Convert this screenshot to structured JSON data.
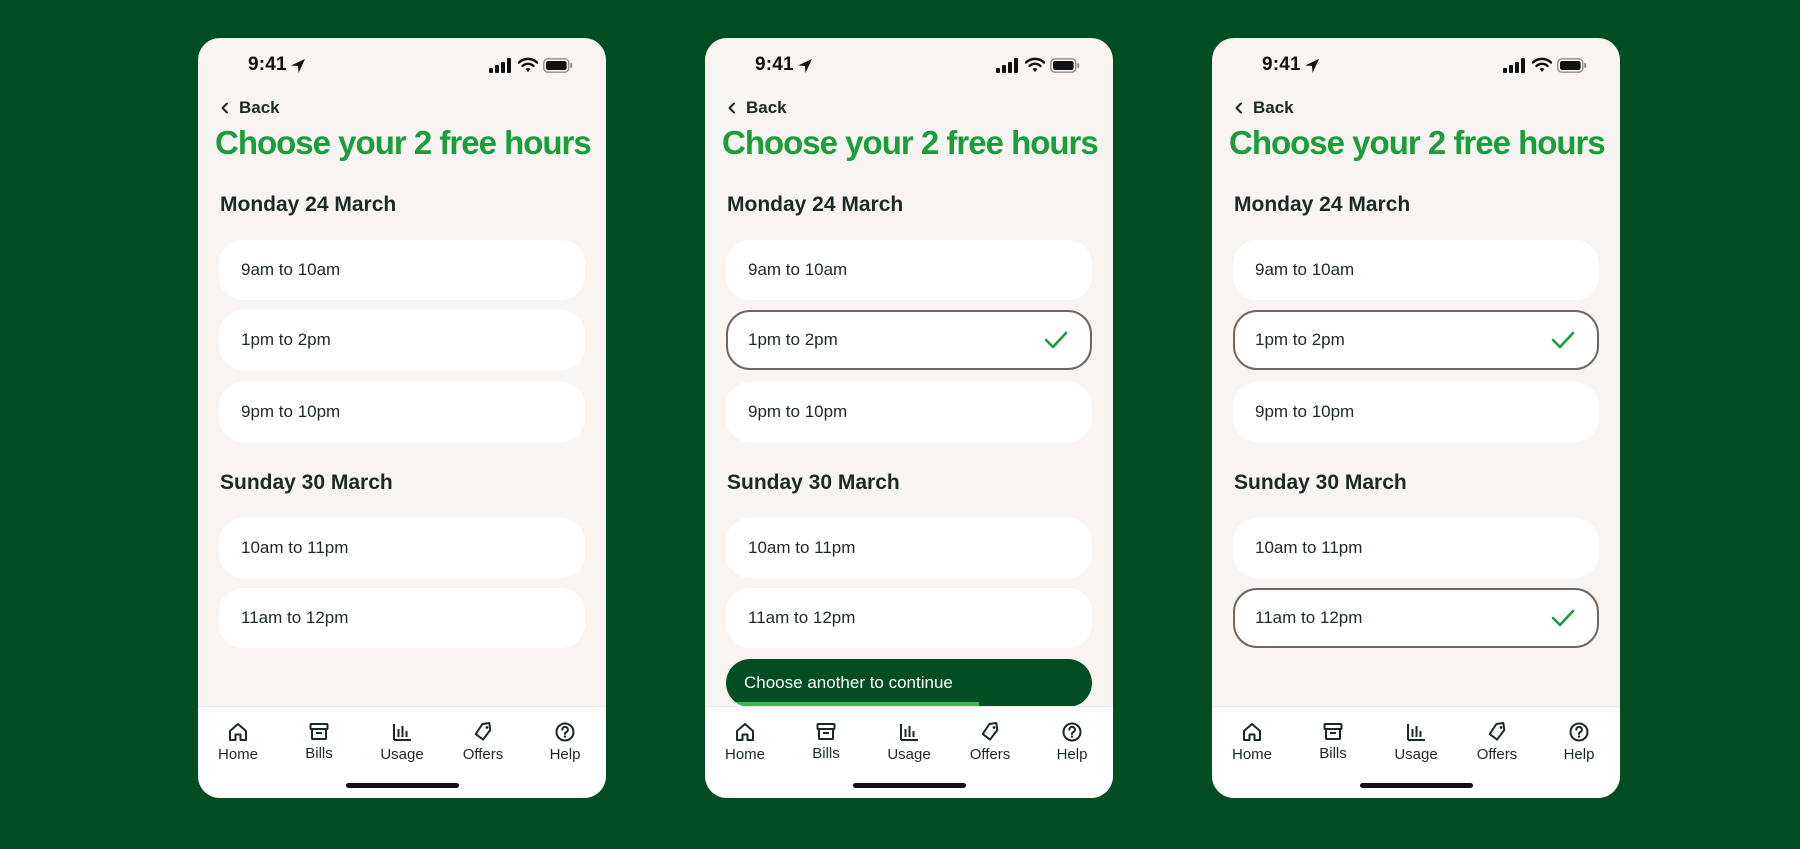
{
  "colors": {
    "background": "#034d22",
    "screen": "#f7f4f1",
    "card": "#ffffff",
    "title_green": "#1a9d3a",
    "text_dark": "#1b2a22",
    "selected_border": "#6e6864",
    "check": "#1a9d3a",
    "toast_bg": "#034d22",
    "toast_progress": "#2fbf4f"
  },
  "screens": [
    {
      "status": {
        "time": "9:41",
        "icons": [
          "location-arrow-icon",
          "signal-icon",
          "wifi-icon",
          "battery-icon"
        ]
      },
      "back_label": "Back",
      "title": "Choose your 2 free hours",
      "sections": [
        {
          "heading": "Monday 24 March",
          "slots": [
            {
              "label": "9am to 10am",
              "selected": false
            },
            {
              "label": "1pm to 2pm",
              "selected": false
            },
            {
              "label": "9pm to 10pm",
              "selected": false
            }
          ]
        },
        {
          "heading": "Sunday 30 March",
          "slots": [
            {
              "label": "10am to 11pm",
              "selected": false
            },
            {
              "label": "11am to 12pm",
              "selected": false
            }
          ]
        }
      ],
      "toast": null,
      "tabs": [
        {
          "label": "Home",
          "icon": "home-icon"
        },
        {
          "label": "Bills",
          "icon": "bills-icon"
        },
        {
          "label": "Usage",
          "icon": "usage-chart-icon"
        },
        {
          "label": "Offers",
          "icon": "tag-icon"
        },
        {
          "label": "Help",
          "icon": "help-icon"
        }
      ]
    },
    {
      "status": {
        "time": "9:41",
        "icons": [
          "location-arrow-icon",
          "signal-icon",
          "wifi-icon",
          "battery-icon"
        ]
      },
      "back_label": "Back",
      "title": "Choose your 2 free hours",
      "sections": [
        {
          "heading": "Monday 24 March",
          "slots": [
            {
              "label": "9am to 10am",
              "selected": false
            },
            {
              "label": "1pm to 2pm",
              "selected": true
            },
            {
              "label": "9pm to 10pm",
              "selected": false
            }
          ]
        },
        {
          "heading": "Sunday 30 March",
          "slots": [
            {
              "label": "10am to 11pm",
              "selected": false
            },
            {
              "label": "11am to 12pm",
              "selected": false
            }
          ]
        }
      ],
      "toast": {
        "label": "Choose another to continue",
        "progress_fraction": 0.69
      },
      "tabs": [
        {
          "label": "Home",
          "icon": "home-icon"
        },
        {
          "label": "Bills",
          "icon": "bills-icon"
        },
        {
          "label": "Usage",
          "icon": "usage-chart-icon"
        },
        {
          "label": "Offers",
          "icon": "tag-icon"
        },
        {
          "label": "Help",
          "icon": "help-icon"
        }
      ]
    },
    {
      "status": {
        "time": "9:41",
        "icons": [
          "location-arrow-icon",
          "signal-icon",
          "wifi-icon",
          "battery-icon"
        ]
      },
      "back_label": "Back",
      "title": "Choose your 2 free hours",
      "sections": [
        {
          "heading": "Monday 24 March",
          "slots": [
            {
              "label": "9am to 10am",
              "selected": false
            },
            {
              "label": "1pm to 2pm",
              "selected": true
            },
            {
              "label": "9pm to 10pm",
              "selected": false
            }
          ]
        },
        {
          "heading": "Sunday 30 March",
          "slots": [
            {
              "label": "10am to 11pm",
              "selected": false
            },
            {
              "label": "11am to 12pm",
              "selected": true
            }
          ]
        }
      ],
      "toast": null,
      "tabs": [
        {
          "label": "Home",
          "icon": "home-icon"
        },
        {
          "label": "Bills",
          "icon": "bills-icon"
        },
        {
          "label": "Usage",
          "icon": "usage-chart-icon"
        },
        {
          "label": "Offers",
          "icon": "tag-icon"
        },
        {
          "label": "Help",
          "icon": "help-icon"
        }
      ]
    }
  ]
}
